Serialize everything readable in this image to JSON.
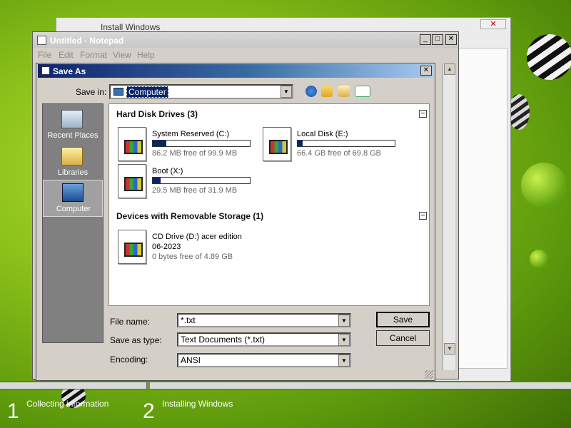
{
  "background_window": {
    "title": "Install Windows",
    "close_label": "✕"
  },
  "installer_steps": [
    {
      "number": "1",
      "label": "Collecting information"
    },
    {
      "number": "2",
      "label": "Installing Windows"
    }
  ],
  "notepad": {
    "title": "Untitled - Notepad",
    "menu": [
      "File",
      "Edit",
      "Format",
      "View",
      "Help"
    ],
    "window_buttons": {
      "minimize": "_",
      "maximize": "□",
      "close": "✕"
    }
  },
  "save_as": {
    "title": "Save As",
    "close_label": "✕",
    "save_in_label": "Save in:",
    "save_in_value": "Computer",
    "places": [
      {
        "label": "Recent Places",
        "icon": "recent-places-icon"
      },
      {
        "label": "Libraries",
        "icon": "libraries-icon"
      },
      {
        "label": "Computer",
        "icon": "computer-icon"
      }
    ],
    "groups": {
      "hard_disks": {
        "title": "Hard Disk Drives (3)",
        "toggle": "−",
        "drives": [
          {
            "name": "System Reserved (C:)",
            "free": "86.2 MB free of 99.9 MB",
            "used_fraction": 0.14
          },
          {
            "name": "Local Disk (E:)",
            "free": "66.4 GB free of 69.8 GB",
            "used_fraction": 0.05
          },
          {
            "name": "Boot (X:)",
            "free": "29.5 MB free of 31.9 MB",
            "used_fraction": 0.08
          }
        ]
      },
      "removable": {
        "title": "Devices with Removable Storage (1)",
        "toggle": "−",
        "drives": [
          {
            "name": "CD Drive (D:) acer edition",
            "name_line2": "06-2023",
            "free": "0 bytes free of 4.89 GB"
          }
        ]
      }
    },
    "file_name_label": "File name:",
    "file_name_value": "*.txt",
    "save_as_type_label": "Save as type:",
    "save_as_type_value": "Text Documents (*.txt)",
    "encoding_label": "Encoding:",
    "encoding_value": "ANSI",
    "save_button": "Save",
    "cancel_button": "Cancel",
    "combo_arrow": "▼"
  },
  "colors": {
    "title_active_start": "#10246a",
    "title_active_end": "#a6caf0",
    "selection": "#0a246a",
    "wallpaper": "#8cc21a"
  }
}
